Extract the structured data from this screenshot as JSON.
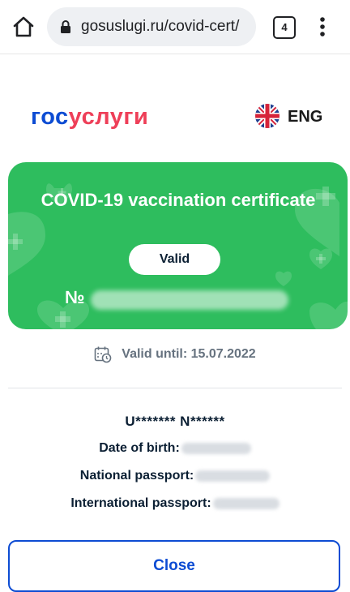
{
  "browser": {
    "url": "gosuslugi.ru/covid-cert/",
    "tab_count": "4",
    "icons": {
      "home": "home-icon",
      "lock": "lock-icon",
      "menu": "more-vert-icon"
    }
  },
  "header": {
    "logo_part1": "гос",
    "logo_part2": "услуги",
    "language": "ENG",
    "colors": {
      "logo_blue": "#0d4cd3",
      "logo_red": "#ee3f58"
    }
  },
  "certificate": {
    "title": "COVID-19 vaccination certificate",
    "status": "Valid",
    "number_label": "№",
    "card_color": "#2ebd5e"
  },
  "validity": {
    "text": "Valid until: 15.07.2022"
  },
  "person": {
    "name": "U******* N******",
    "dob_label": "Date of birth:",
    "national_passport_label": "National passport:",
    "international_passport_label": "International passport:"
  },
  "actions": {
    "close_label": "Close"
  }
}
